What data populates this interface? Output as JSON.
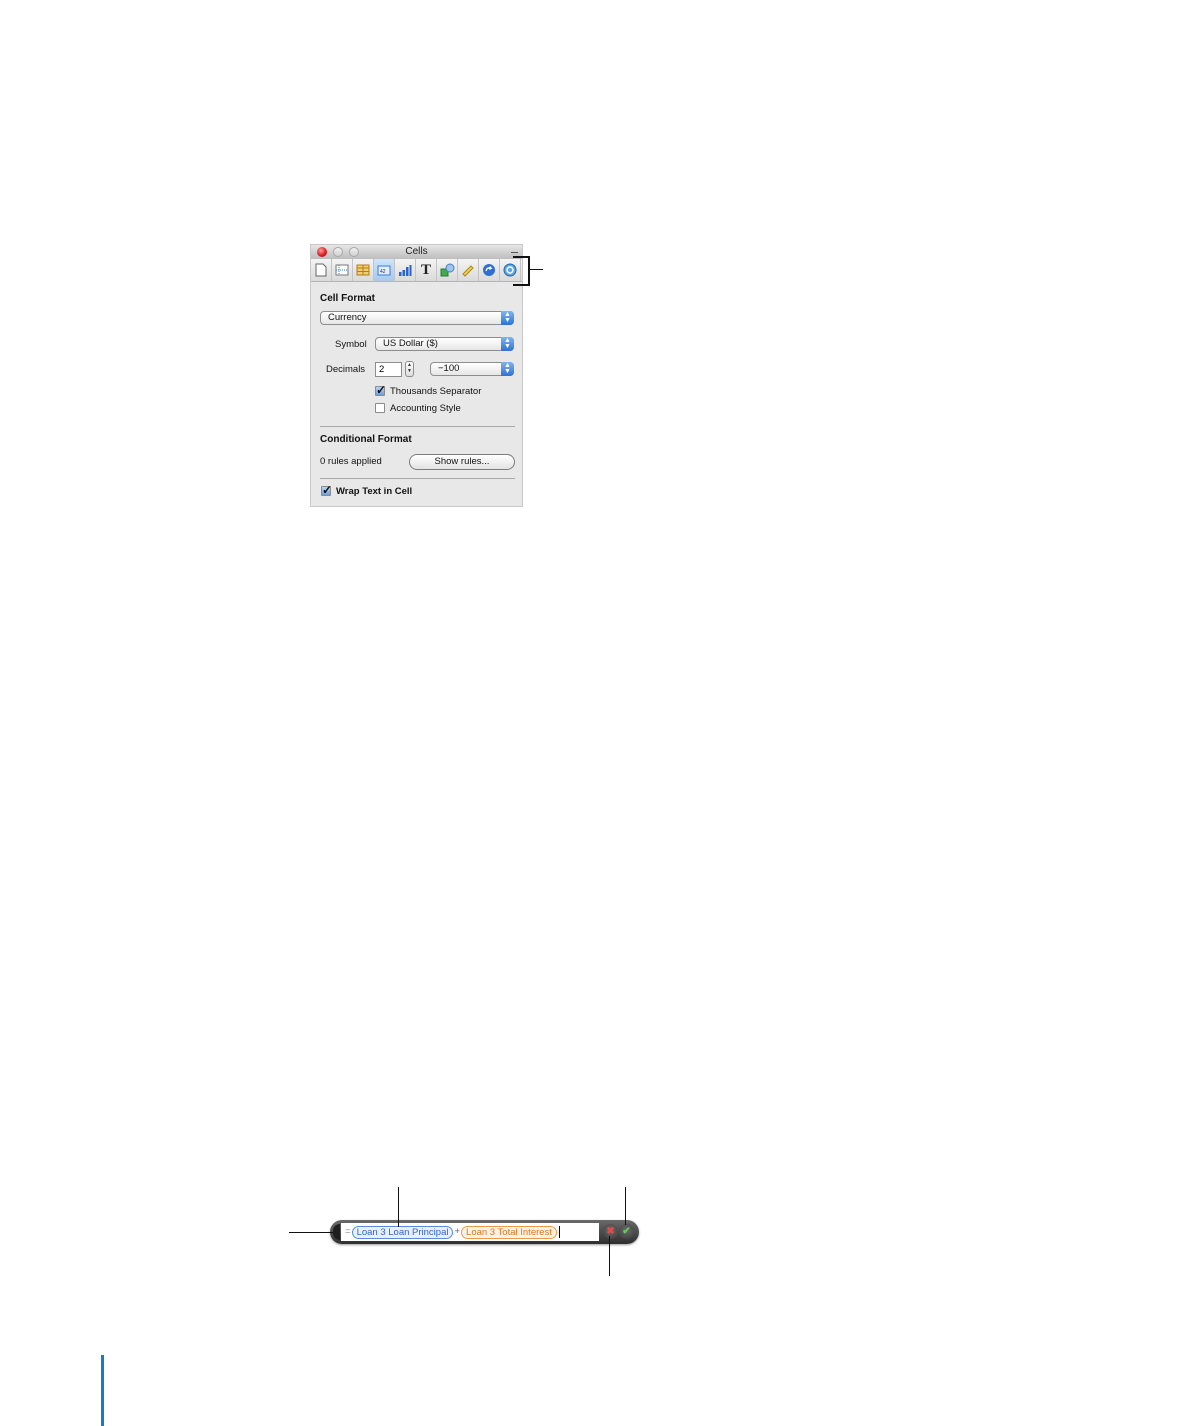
{
  "inspector": {
    "window_title": "Cells",
    "toolbar_icons": [
      "document-inspector-icon",
      "table-inspector-icon",
      "sheet-inspector-icon",
      "cells-inspector-icon",
      "chart-inspector-icon",
      "text-inspector-icon",
      "graphic-inspector-icon",
      "metrics-inspector-icon",
      "hyperlink-inspector-icon",
      "quicktime-inspector-icon"
    ],
    "active_tool_index": 3,
    "cell_format": {
      "title": "Cell Format",
      "format_value": "Currency",
      "symbol_label": "Symbol",
      "symbol_value": "US Dollar ($)",
      "decimals_label": "Decimals",
      "decimals_value": "2",
      "negative_value": "−100",
      "thousands_label": "Thousands Separator",
      "thousands_checked": true,
      "accounting_label": "Accounting Style",
      "accounting_checked": false
    },
    "conditional_format": {
      "title": "Conditional Format",
      "rules_status": "0 rules applied",
      "show_rules_label": "Show rules..."
    },
    "wrap_text": {
      "label": "Wrap Text in Cell",
      "checked": true
    }
  },
  "formula_editor": {
    "equals": "=",
    "token1": "Loan 3 Loan Principal",
    "operator": "+",
    "token2": "Loan 3 Total Interest",
    "cancel_glyph": "✖",
    "accept_glyph": "✔"
  },
  "colors": {
    "token_blue": "#3066c9",
    "token_orange": "#d9791f",
    "margin_bar": "#1a7ac3"
  }
}
